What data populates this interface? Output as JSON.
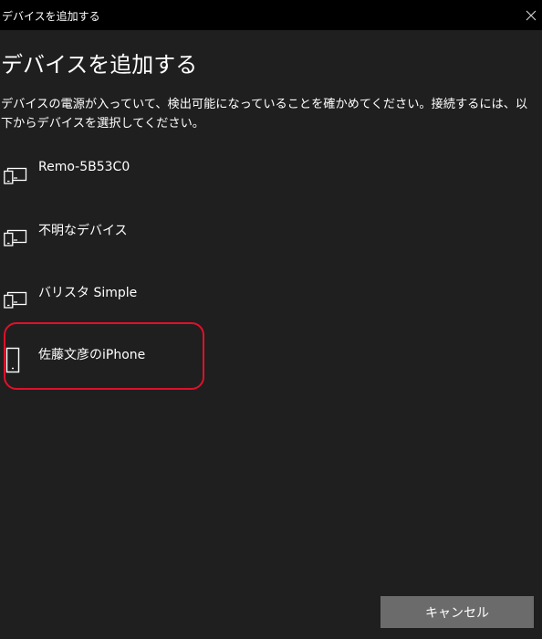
{
  "window": {
    "title": "デバイスを追加する"
  },
  "heading": "デバイスを追加する",
  "description": "デバイスの電源が入っていて、検出可能になっていることを確かめてください。接続するには、以下からデバイスを選択してください。",
  "devices": [
    {
      "name": "Remo-5B53C0",
      "icon": "tablet-pc-icon"
    },
    {
      "name": "不明なデバイス",
      "icon": "tablet-pc-icon"
    },
    {
      "name": "バリスタ Simple",
      "icon": "tablet-pc-icon"
    },
    {
      "name": "佐藤文彦のiPhone",
      "icon": "phone-icon"
    }
  ],
  "buttons": {
    "cancel": "キャンセル"
  },
  "colors": {
    "background": "#1f1f1f",
    "titlebar": "#000000",
    "button": "#6b6b6b",
    "highlight": "#e0102a"
  }
}
